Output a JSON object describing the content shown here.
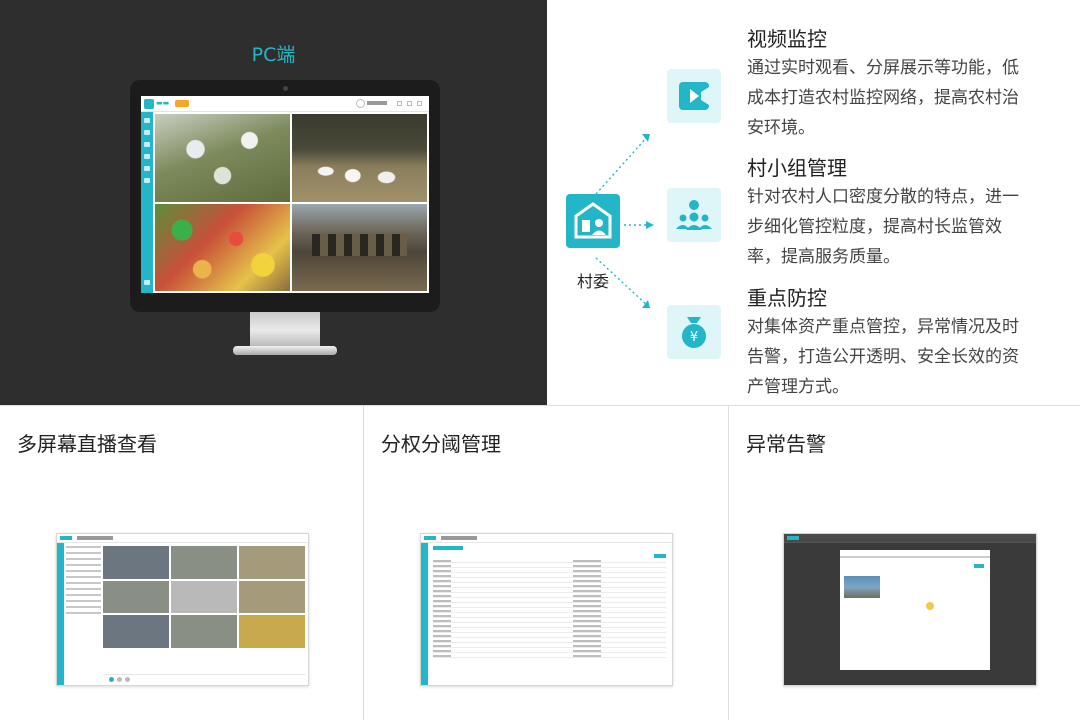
{
  "pc_section": {
    "title": "PC端",
    "screen": {
      "tiles": [
        "orchard-camera",
        "geese-camera",
        "market-camera",
        "house-camera"
      ]
    }
  },
  "hub": {
    "label": "村委",
    "icon": "village-house-icon"
  },
  "features": [
    {
      "title": "视频监控",
      "desc_lines": [
        "通过实时观看、分屏展示等功能，低",
        "成本打造农村监控网络，提高农村治",
        "安环境。"
      ],
      "icon": "video-camera-icon"
    },
    {
      "title": "村小组管理",
      "desc_lines": [
        "针对农村人口密度分散的特点，进一",
        "步细化管控粒度，提高村长监管效",
        "率，提高服务质量。"
      ],
      "icon": "group-people-icon"
    },
    {
      "title": "重点防控",
      "desc_lines": [
        "对集体资产重点管控，异常情况及时",
        "告警，打造公开透明、安全长效的资",
        "产管理方式。"
      ],
      "icon": "money-bag-icon"
    }
  ],
  "cards": [
    {
      "title": "多屏幕直播查看"
    },
    {
      "title": "分权分阈管理"
    },
    {
      "title": "异常告警"
    }
  ],
  "colors": {
    "accent": "#23b6c9",
    "dark_panel": "#2e2e2e",
    "icon_bg": "#dff6f9"
  }
}
